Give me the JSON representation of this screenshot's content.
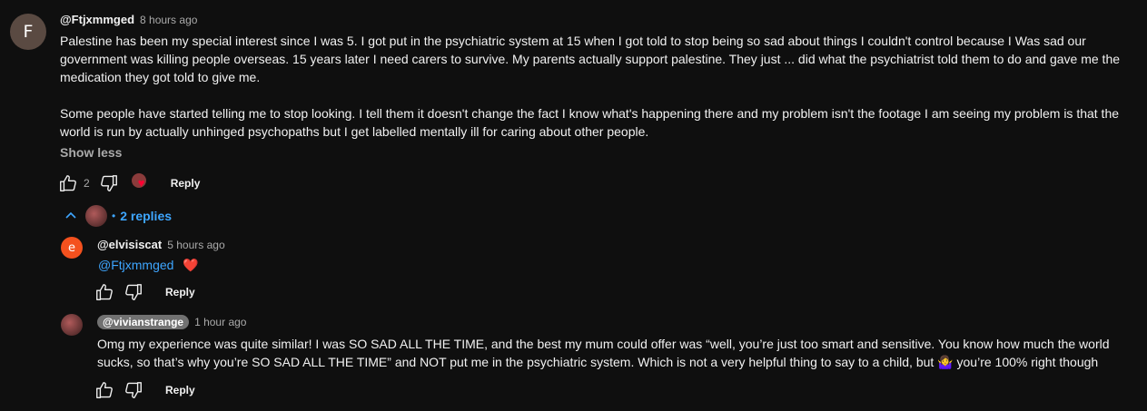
{
  "comment": {
    "avatar_letter": "F",
    "avatar_color": "#5a4a42",
    "author": "@Ftjxmmged",
    "time": "8 hours ago",
    "paragraph1": "Palestine has been my special interest since I was 5. I got put in the psychiatric system at 15 when I got told to stop being so sad about things I couldn't control because I Was sad our government was killing people overseas. 15 years later I need carers to survive. My parents actually support palestine. They just ... did what the psychiatrist told them to do and gave me the medication they got told to give me.",
    "paragraph2": "Some people have started telling me to stop looking. I tell them it doesn't change the fact I know what's happening there and my problem isn't the footage I am seeing my problem is that the world is run by actually unhinged psychopaths but I get labelled mentally ill for caring about other people.",
    "show_less": "Show less",
    "like_count": "2",
    "reply_label": "Reply",
    "replies_toggle": "2 replies",
    "heart_color": "#ff0033",
    "link_color": "#3ea6ff"
  },
  "replies": [
    {
      "avatar_letter": "e",
      "avatar_color": "#f4511e",
      "author": "@elvisiscat",
      "time": "5 hours ago",
      "mention": "@Ftjxmmged",
      "emoji": "❤️",
      "reply_label": "Reply"
    },
    {
      "author": "@vivianstrange",
      "time": "1 hour ago",
      "text_part1": "Omg my experience was quite similar! I was SO SAD ALL THE TIME, and the best my mum could offer was “well, you’re just too smart and sensitive. You know how much the world sucks, so that’s why you’re SO SAD ALL THE TIME” and NOT put me in the psychiatric system. Which is not a very helpful thing to say to a child, but ",
      "emoji": "🤷‍♀️",
      "text_part2": " you’re 100% right though",
      "reply_label": "Reply"
    }
  ]
}
